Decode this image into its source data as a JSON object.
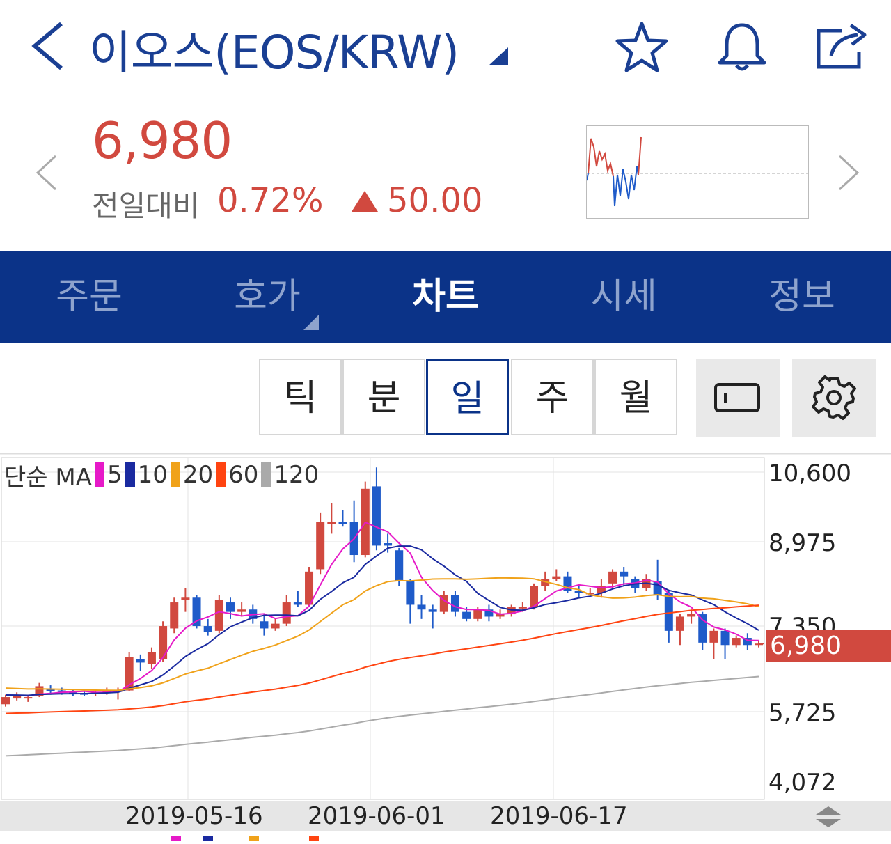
{
  "header": {
    "title": "이오스(EOS/KRW)",
    "icons": [
      "back-icon",
      "star-icon",
      "bell-icon",
      "share-icon"
    ]
  },
  "price": {
    "current": "6,980",
    "compare_label": "전일대비",
    "change_rate": "0.72%",
    "change_amount": "50.00",
    "up_color": "#d1493f"
  },
  "tabs": [
    {
      "label": "주문"
    },
    {
      "label": "호가"
    },
    {
      "label": "차트",
      "active": true
    },
    {
      "label": "시세"
    },
    {
      "label": "정보"
    }
  ],
  "periods": [
    {
      "label": "틱"
    },
    {
      "label": "분"
    },
    {
      "label": "일",
      "active": true
    },
    {
      "label": "주"
    },
    {
      "label": "월"
    }
  ],
  "legend": {
    "prefix": "단순 MA",
    "items": [
      {
        "label": "5",
        "color": "#e619c8"
      },
      {
        "label": "10",
        "color": "#1a2aa0"
      },
      {
        "label": "20",
        "color": "#f0a21a"
      },
      {
        "label": "60",
        "color": "#ff4411"
      },
      {
        "label": "120",
        "color": "#aaaaaa"
      }
    ]
  },
  "chart_data": {
    "type": "candlestick",
    "y_ticks": [
      "10,600",
      "8,975",
      "7,350",
      "5,725",
      "4,072"
    ],
    "ylim": [
      4072,
      10600
    ],
    "x_ticks": [
      "2019-05-16",
      "2019-06-01",
      "2019-06-17"
    ],
    "last_price": "6,980",
    "colors": {
      "up": "#d1493f",
      "down": "#1f5bc9"
    }
  }
}
